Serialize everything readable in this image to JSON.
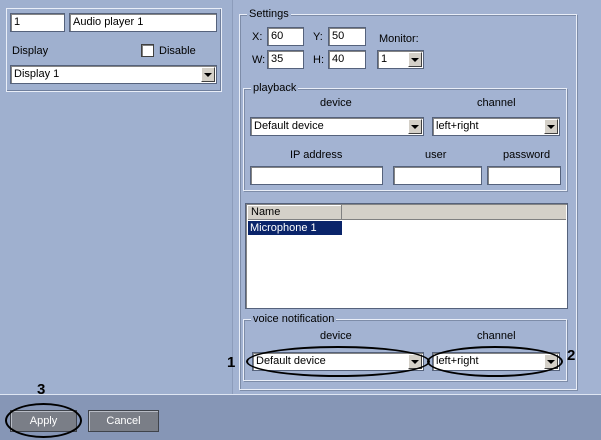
{
  "camera": {
    "id": "1",
    "name": "Audio player 1",
    "display_label": "Display",
    "disable_label": "Disable",
    "display_value": "Display 1"
  },
  "settings": {
    "legend": "Settings",
    "x_label": "X:",
    "x_value": "60",
    "y_label": "Y:",
    "y_value": "50",
    "w_label": "W:",
    "w_value": "35",
    "h_label": "H:",
    "h_value": "40",
    "monitor_label": "Monitor:",
    "monitor_value": "1"
  },
  "playback": {
    "legend": "playback",
    "device_header": "device",
    "channel_header": "channel",
    "device_value": "Default device",
    "channel_value": "left+right",
    "ip_label": "IP address",
    "user_label": "user",
    "password_label": "password",
    "ip_value": "",
    "user_value": "",
    "password_value": ""
  },
  "microphones": {
    "column_name": "Name",
    "rows": [
      "Microphone 1"
    ]
  },
  "voice_notification": {
    "legend": "voice notification",
    "device_header": "device",
    "channel_header": "channel",
    "device_value": "Default device",
    "channel_value": "left+right"
  },
  "annotations": {
    "one": "1",
    "two": "2",
    "three": "3"
  },
  "footer": {
    "apply_label": "Apply",
    "cancel_label": "Cancel"
  }
}
